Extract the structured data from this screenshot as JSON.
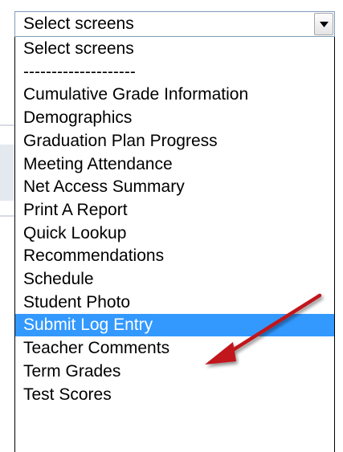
{
  "select": {
    "value": "Select screens"
  },
  "options": [
    "Select screens",
    "--------------------",
    "Cumulative Grade Information",
    "Demographics",
    "Graduation Plan Progress",
    "Meeting Attendance",
    "Net Access Summary",
    "Print A Report",
    "Quick Lookup",
    "Recommendations",
    "Schedule",
    "Student Photo",
    "Submit Log Entry",
    "Teacher Comments",
    "Term Grades",
    "Test Scores"
  ],
  "highlighted_option": "Submit Log Entry",
  "colors": {
    "highlight": "#3399ff",
    "annotation_arrow": "#c0161a"
  },
  "icons": {
    "dropdown": "chevron-down-icon",
    "annotation": "red-arrow-icon"
  }
}
